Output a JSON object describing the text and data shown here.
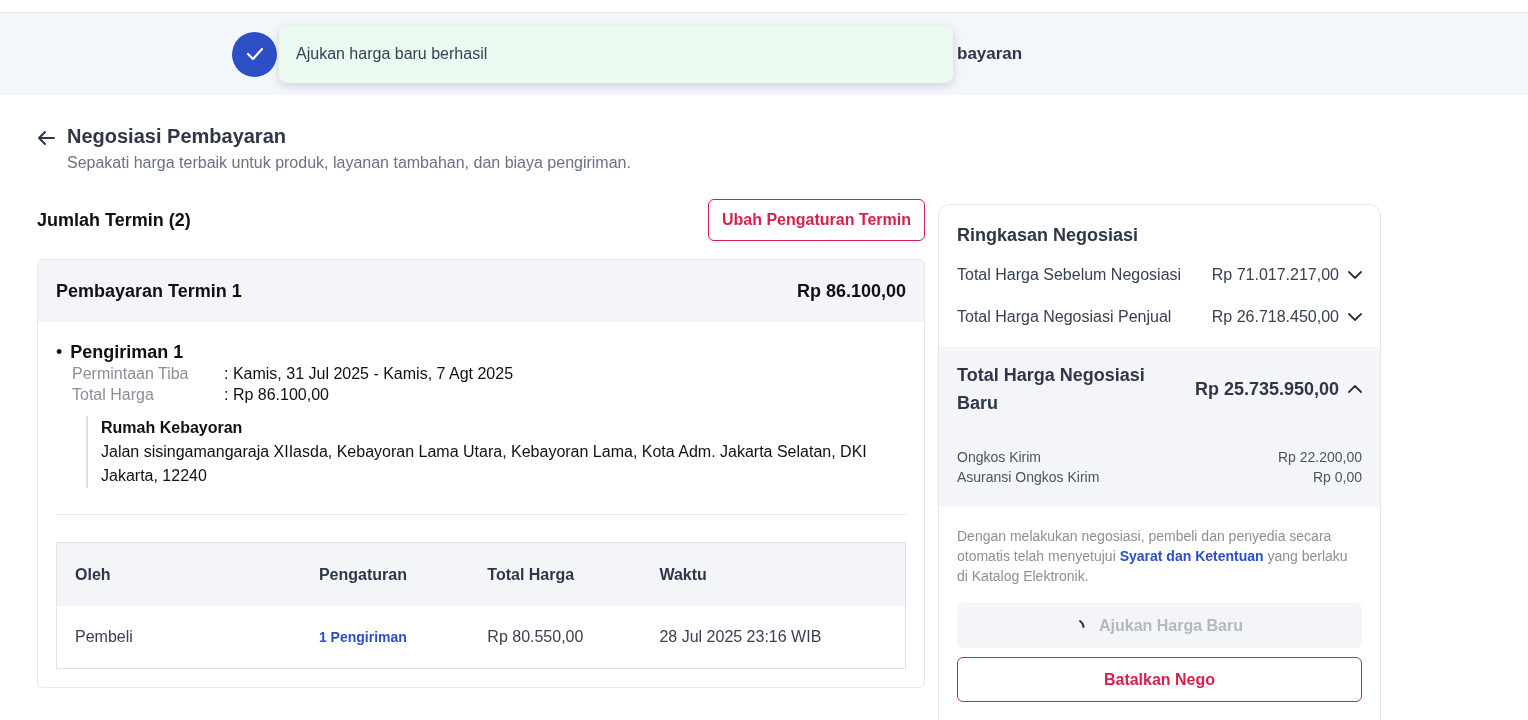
{
  "stepper": {
    "step_label": "bayaran",
    "step_done": true
  },
  "toast": {
    "message": "Ajukan harga baru berhasil"
  },
  "header": {
    "title": "Negosiasi Pembayaran",
    "subtitle": "Sepakati harga terbaik untuk produk, layanan tambahan, dan biaya pengiriman."
  },
  "termin": {
    "heading": "Jumlah Termin (2)",
    "edit_button": "Ubah Pengaturan Termin"
  },
  "payment": {
    "title": "Pembayaran Termin 1",
    "amount": "Rp 86.100,00",
    "shipment": {
      "bullet": "•",
      "title": "Pengiriman 1",
      "fields": [
        {
          "label": "Permintaan Tiba",
          "value": ": Kamis, 31 Jul 2025 - Kamis, 7 Agt 2025"
        },
        {
          "label": "Total Harga",
          "value": ": Rp 86.100,00"
        }
      ],
      "address_name": "Rumah Kebayoran",
      "address": "Jalan sisingamangaraja XIIasda, Kebayoran Lama Utara, Kebayoran Lama, Kota Adm. Jakarta Selatan, DKI Jakarta, 12240"
    },
    "table": {
      "columns": [
        "Oleh",
        "Pengaturan",
        "Total Harga",
        "Waktu"
      ],
      "rows": [
        {
          "by": "Pembeli",
          "setting": "1 Pengiriman",
          "total": "Rp 80.550,00",
          "time": "28 Jul 2025 23:16 WIB"
        }
      ]
    }
  },
  "summary": {
    "title": "Ringkasan Negosiasi",
    "rows": [
      {
        "label": "Total Harga Sebelum Negosiasi",
        "value": "Rp 71.017.217,00",
        "expanded": false
      },
      {
        "label": "Total Harga Negosiasi Penjual",
        "value": "Rp 26.718.450,00",
        "expanded": false
      }
    ],
    "total": {
      "label": "Total Harga Negosiasi Baru",
      "value": "Rp 25.735.950,00",
      "expanded": true,
      "details": [
        {
          "label": "Ongkos Kirim",
          "value": "Rp 22.200,00"
        },
        {
          "label": "Asuransi Ongkos Kirim",
          "value": "Rp 0,00"
        }
      ]
    },
    "disclaimer": {
      "before": "Dengan melakukan negosiasi, pembeli dan penyedia secara otomatis telah menyetujui",
      "link": "Syarat dan Ketentuan",
      "after": "yang berlaku di Katalog Elektronik."
    },
    "submit_button": {
      "label": "Ajukan Harga Baru",
      "disabled": true,
      "loading": true
    },
    "cancel_button": "Batalkan Nego"
  }
}
